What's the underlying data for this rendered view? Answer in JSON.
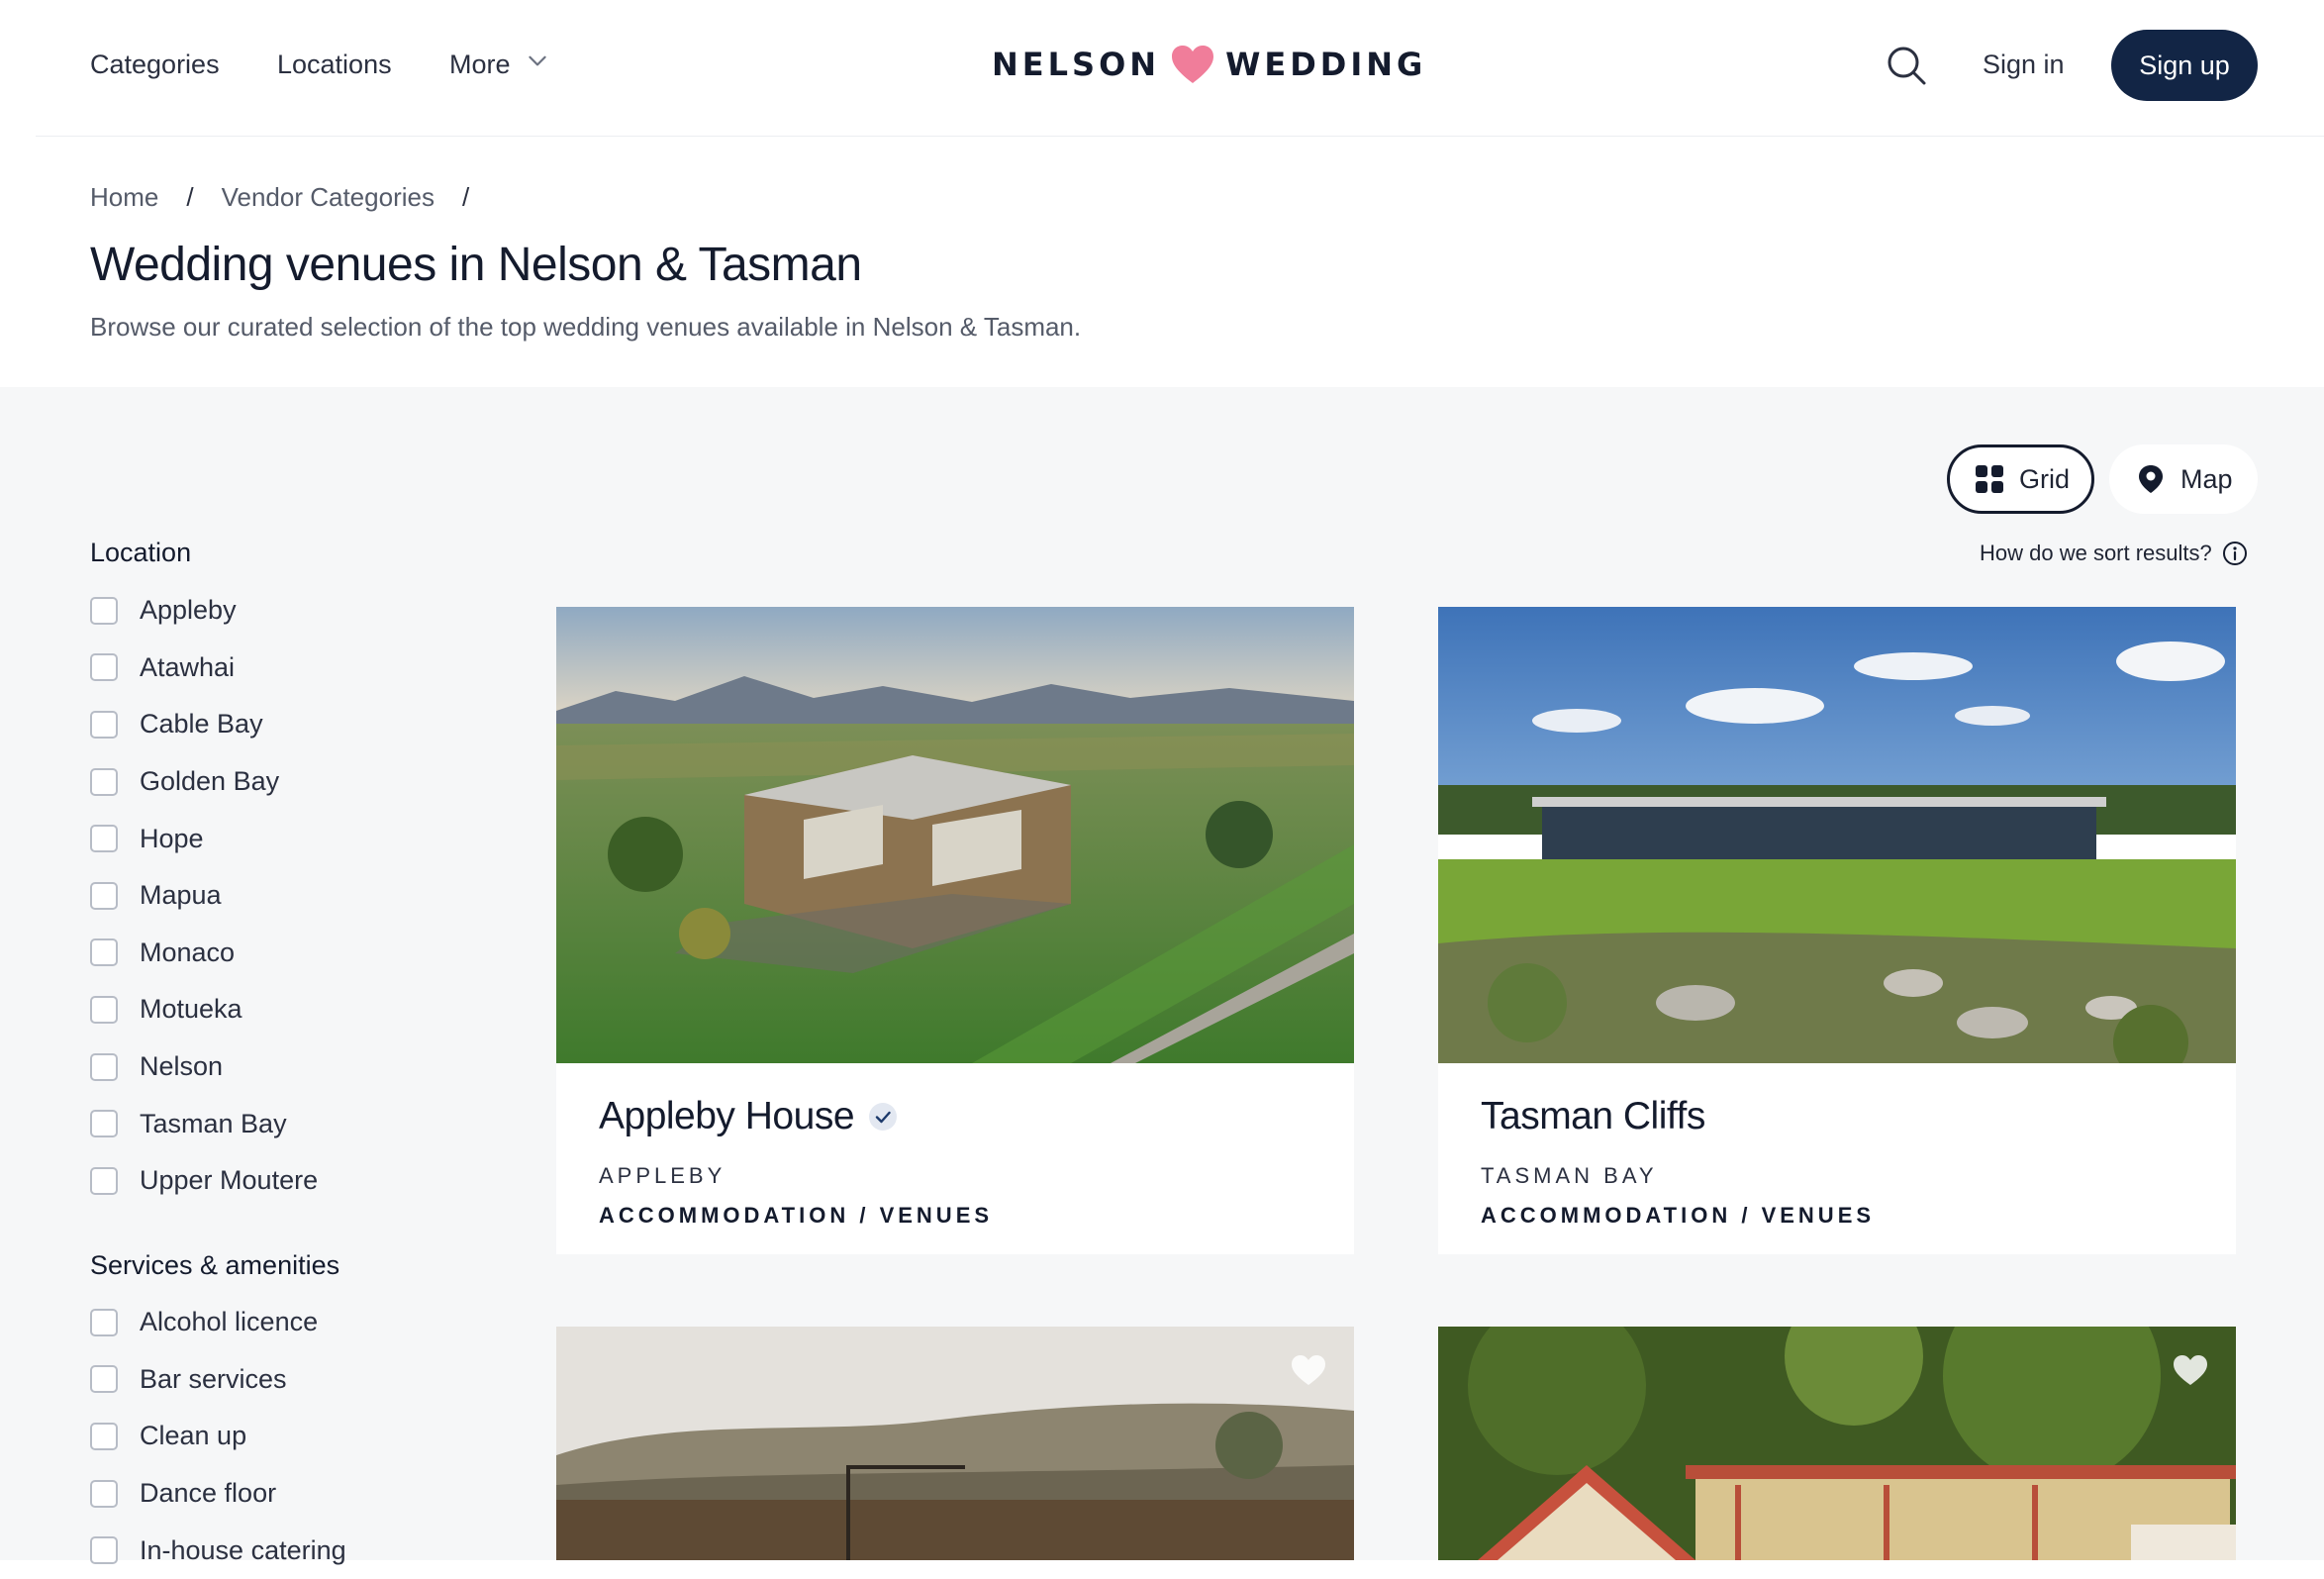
{
  "header": {
    "nav": [
      {
        "label": "Categories"
      },
      {
        "label": "Locations"
      },
      {
        "label": "More"
      }
    ],
    "logo": {
      "left_word": "NELSON",
      "right_word": "WEDDING",
      "heart_color": "#f07d9a"
    },
    "sign_in": "Sign in",
    "sign_up": "Sign up",
    "accent_color": "#122545"
  },
  "breadcrumb": [
    "Home",
    "Vendor Categories"
  ],
  "page": {
    "title": "Wedding venues in Nelson & Tasman",
    "subtitle": "Browse our curated selection of the top wedding venues available in Nelson & Tasman."
  },
  "view": {
    "grid_label": "Grid",
    "map_label": "Map",
    "selected": "Grid",
    "sort_help": "How do we sort results?"
  },
  "filters": {
    "location": {
      "heading": "Location",
      "options": [
        "Appleby",
        "Atawhai",
        "Cable Bay",
        "Golden Bay",
        "Hope",
        "Mapua",
        "Monaco",
        "Motueka",
        "Nelson",
        "Tasman Bay",
        "Upper Moutere"
      ]
    },
    "services": {
      "heading": "Services & amenities",
      "options": [
        "Alcohol licence",
        "Bar services",
        "Clean up",
        "Dance floor",
        "In-house catering"
      ]
    }
  },
  "venues": [
    {
      "name": "Appleby House",
      "verified": true,
      "location": "APPLEBY",
      "category": "ACCOMMODATION / VENUES",
      "image": "aerial-modern-house-farmland"
    },
    {
      "name": "Tasman Cliffs",
      "verified": false,
      "location": "TASMAN BAY",
      "category": "ACCOMMODATION / VENUES",
      "image": "glass-pavilion-lawn-blue-sky"
    },
    {
      "image": "rustic-garden-hills",
      "favorite_icon": "heart-outline-icon"
    },
    {
      "image": "villa-verandah-garden",
      "favorite_icon": "heart-outline-icon"
    }
  ]
}
